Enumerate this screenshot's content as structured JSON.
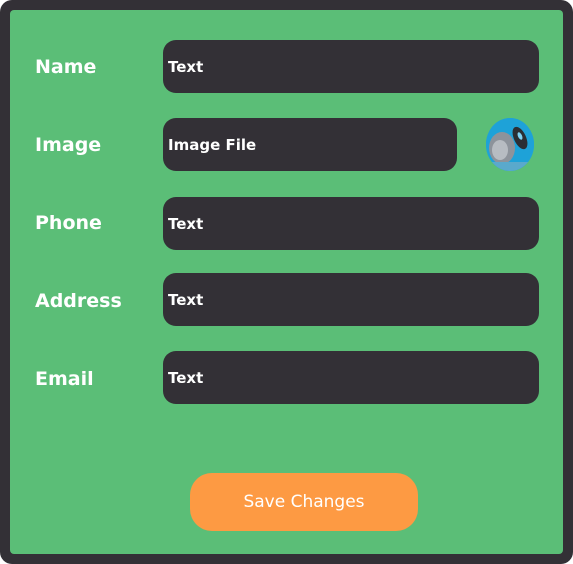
{
  "form": {
    "fields": [
      {
        "label": "Name",
        "value": "Text"
      },
      {
        "label": "Image",
        "value": "Image File"
      },
      {
        "label": "Phone",
        "value": "Text"
      },
      {
        "label": "Address",
        "value": "Text"
      },
      {
        "label": "Email",
        "value": "Text"
      }
    ],
    "avatar_icon": "avatar-thumbnail",
    "save_label": "Save Changes"
  },
  "colors": {
    "panel_bg": "#5bbe77",
    "frame_bg": "#333036",
    "input_bg": "#333036",
    "button_bg": "#fd9a43",
    "text": "#ffffff"
  }
}
